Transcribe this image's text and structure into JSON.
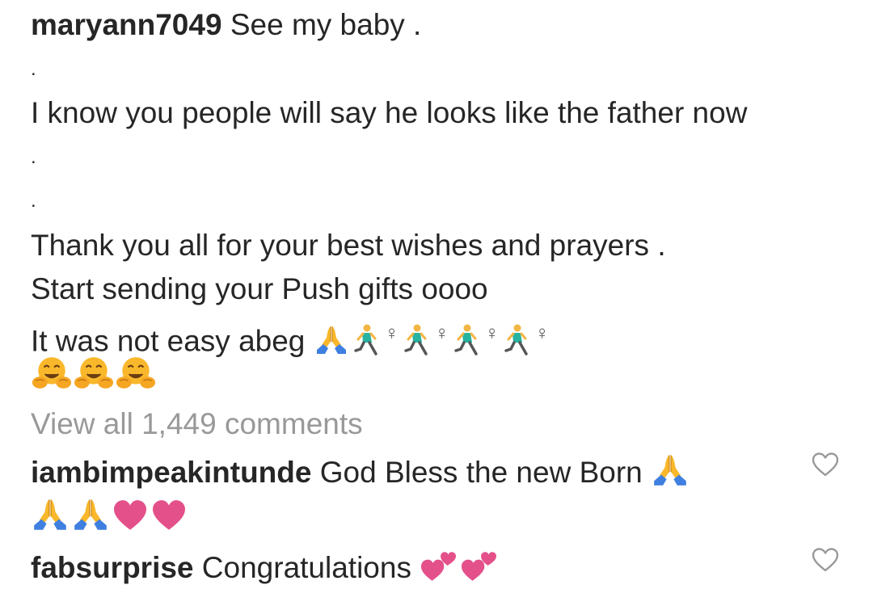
{
  "post": {
    "username": "maryann7049",
    "caption_line_1": "See my baby .",
    "dot_1": ".",
    "caption_line_2": "I know you people will say he looks like the father now",
    "dot_2": ".",
    "dot_3": ".",
    "caption_line_3": "Thank you all for your best wishes and prayers .",
    "caption_line_4": "Start sending your Push gifts oooo",
    "caption_line_5": "It was not easy abeg",
    "emojis_line_5": [
      "praying-hands",
      "woman-running",
      "woman-running",
      "woman-running",
      "woman-running"
    ],
    "emojis_line_6": [
      "hugging-face",
      "hugging-face",
      "hugging-face"
    ]
  },
  "view_all_comments": "View all 1,449 comments",
  "comments": [
    {
      "username": "iambimpeakintunde",
      "text": "God Bless the new Born",
      "emojis": [
        "praying-hands",
        "praying-hands",
        "praying-hands",
        "heart",
        "heart"
      ]
    },
    {
      "username": "fabsurprise",
      "text": "Congratulations",
      "emojis": [
        "two-hearts",
        "two-hearts"
      ]
    }
  ],
  "colors": {
    "text": "#262626",
    "muted": "#999999",
    "heart_outline": "#999999",
    "emoji_yellow": "#F9B82B",
    "emoji_blue": "#3F7FE0",
    "emoji_pink": "#E4508A",
    "runner_teal": "#27B3A0"
  }
}
